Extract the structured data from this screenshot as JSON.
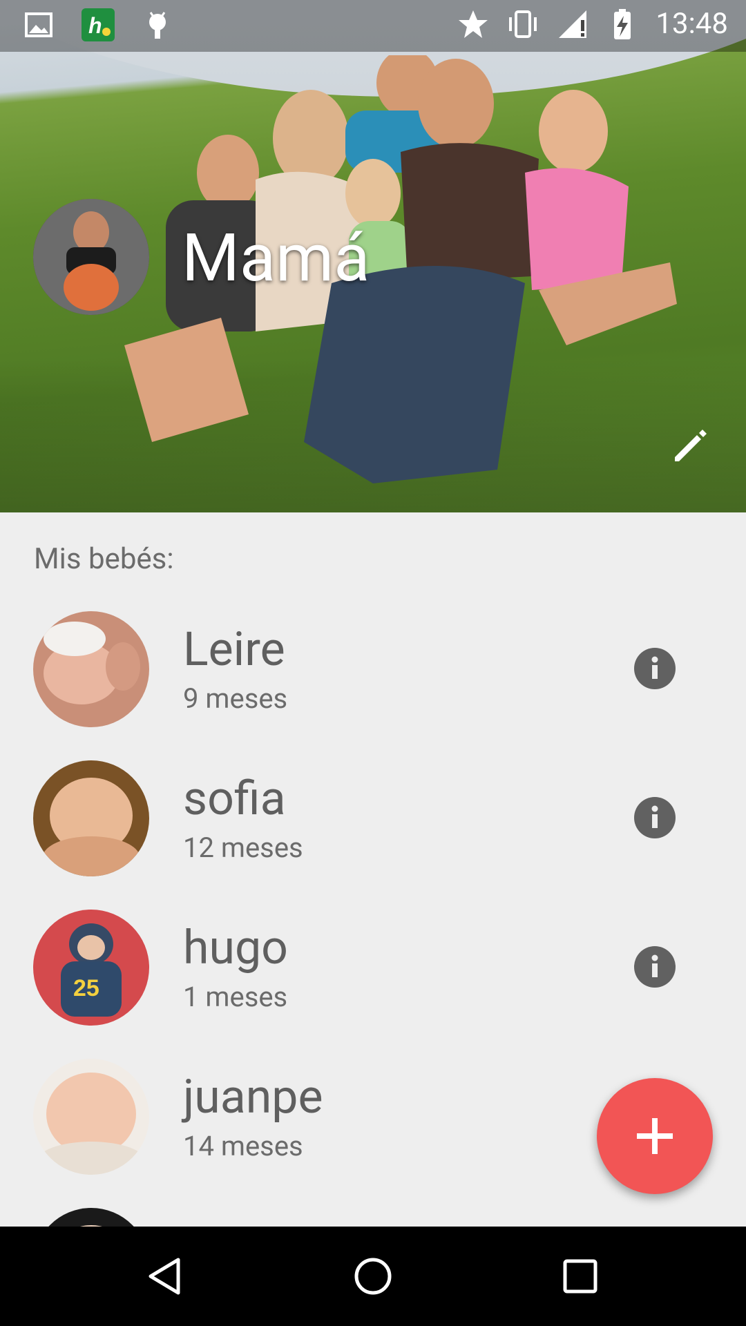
{
  "status_bar": {
    "time": "13:48",
    "left_icons": [
      "image-icon",
      "h-app-icon",
      "android-icon"
    ],
    "right_icons": [
      "star-icon",
      "vibrate-icon",
      "signal-icon",
      "battery-charging-icon"
    ]
  },
  "profile": {
    "name": "Mamá",
    "edit_icon": "pencil-icon"
  },
  "section": {
    "title": "Mis bebés:"
  },
  "babies": [
    {
      "name": "Leire",
      "age": "9 meses"
    },
    {
      "name": "sofia",
      "age": "12 meses"
    },
    {
      "name": "hugo",
      "age": "1 meses"
    },
    {
      "name": "juanpe",
      "age": "14 meses"
    }
  ],
  "fab": {
    "icon": "plus-icon"
  },
  "colors": {
    "fab": "#f25555",
    "background": "#eeeeee",
    "text_primary": "#5f5f5f",
    "info_icon": "#616161"
  },
  "navigation": [
    "back-icon",
    "home-icon",
    "recents-icon"
  ]
}
